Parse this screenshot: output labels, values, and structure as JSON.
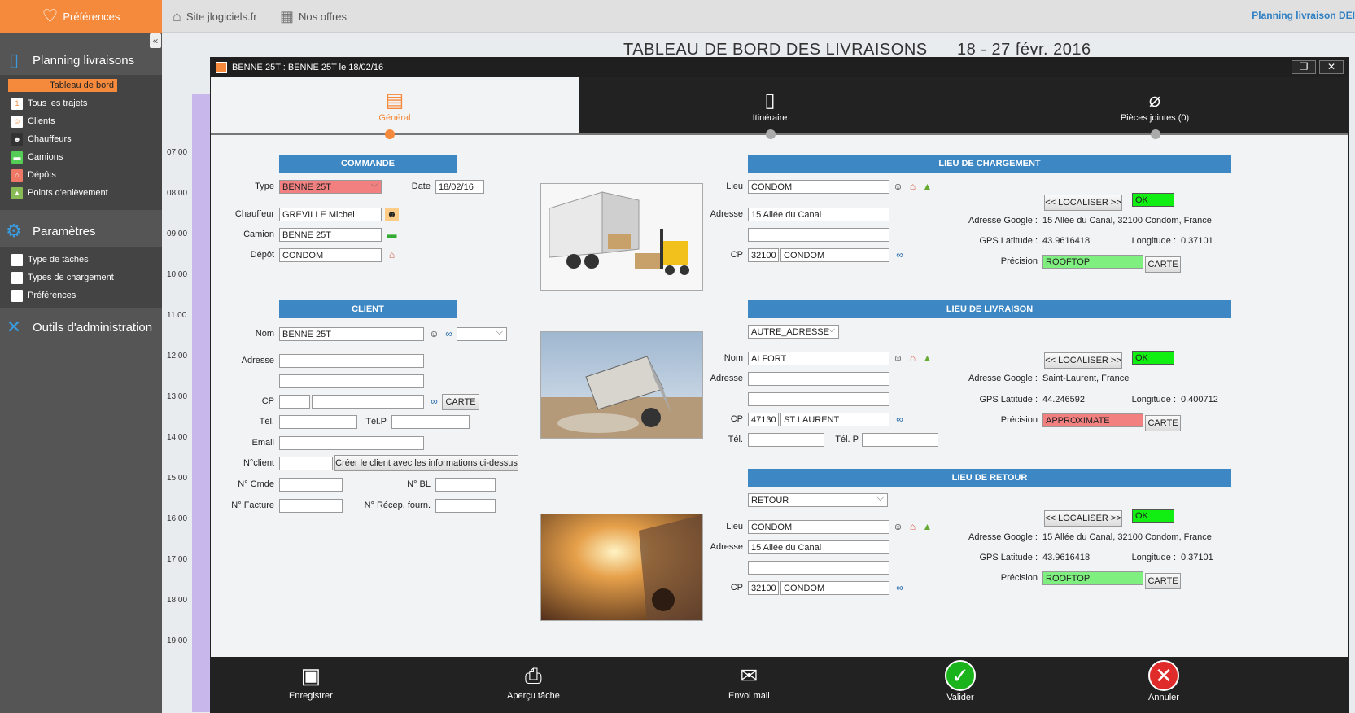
{
  "topbar": {
    "prefs_label": "Préférences",
    "site_link": "Site jlogiciels.fr",
    "offers_link": "Nos offres",
    "right_title": "Planning livraison DEI"
  },
  "sidebar": {
    "planning_title": "Planning livraisons",
    "planning_items": [
      "Tableau de bord",
      "Tous les trajets",
      "Clients",
      "Chauffeurs",
      "Camions",
      "Dépôts",
      "Points d'enlèvement"
    ],
    "params_title": "Paramètres",
    "params_items": [
      "Type de tâches",
      "Types de chargement",
      "Préférences"
    ],
    "admin_title": "Outils d'administration"
  },
  "dashboard": {
    "title": "TABLEAU DE BORD DES LIVRAISONS",
    "period": "18 - 27 févr. 2016",
    "hours": [
      "07.00",
      "08.00",
      "09.00",
      "10.00",
      "11.00",
      "12.00",
      "13.00",
      "14.00",
      "15.00",
      "16.00",
      "17.00",
      "18.00",
      "19.00"
    ]
  },
  "modal": {
    "title": "BENNE 25T : BENNE 25T le 18/02/16",
    "tabs": [
      "Général",
      "Itinéraire",
      "Pièces jointes (0)"
    ]
  },
  "commande": {
    "header": "COMMANDE",
    "type_label": "Type",
    "type_value": "BENNE 25T",
    "date_label": "Date",
    "date_value": "18/02/16",
    "chauffeur_label": "Chauffeur",
    "chauffeur_value": "GREVILLE Michel",
    "camion_label": "Camion",
    "camion_value": "BENNE 25T",
    "depot_label": "Dépôt",
    "depot_value": "CONDOM"
  },
  "client": {
    "header": "CLIENT",
    "nom_label": "Nom",
    "nom_value": "BENNE 25T",
    "adresse_label": "Adresse",
    "cp_label": "CP",
    "carte_label": "CARTE",
    "tel_label": "Tél.",
    "telp_label": "Tél.P",
    "email_label": "Email",
    "nclient_label": "N°client",
    "create_button": "Créer le client avec les informations ci-dessus",
    "ncmde_label": "N° Cmde",
    "nbl_label": "N° BL",
    "nfacture_label": "N° Facture",
    "nrecep_label": "N° Récep. fourn."
  },
  "chargement": {
    "header": "LIEU DE CHARGEMENT",
    "lieu_label": "Lieu",
    "lieu_value": "CONDOM",
    "adresse_label": "Adresse",
    "adresse_value": "15 Allée du Canal",
    "cp_label": "CP",
    "cp_value": "32100",
    "ville_value": "CONDOM",
    "localiser": "<< LOCALISER >>",
    "status": "OK",
    "google_label": "Adresse Google :",
    "google_value": "15 Allée du Canal, 32100 Condom, France",
    "lat_label": "GPS Latitude :",
    "lat_value": "43.9616418",
    "lon_label": "Longitude :",
    "lon_value": "0.37101",
    "prec_label": "Précision",
    "prec_value": "ROOFTOP",
    "carte": "CARTE"
  },
  "livraison": {
    "header": "LIEU DE LIVRAISON",
    "mode_value": "AUTRE_ADRESSE",
    "nom_label": "Nom",
    "nom_value": "ALFORT",
    "adresse_label": "Adresse",
    "cp_label": "CP",
    "cp_value": "47130",
    "ville_value": "ST LAURENT",
    "tel_label": "Tél.",
    "telp_label": "Tél. P",
    "localiser": "<< LOCALISER >>",
    "status": "OK",
    "google_label": "Adresse Google :",
    "google_value": "Saint-Laurent, France",
    "lat_label": "GPS Latitude :",
    "lat_value": "44.246592",
    "lon_label": "Longitude :",
    "lon_value": "0.400712",
    "prec_label": "Précision",
    "prec_value": "APPROXIMATE",
    "carte": "CARTE"
  },
  "retour": {
    "header": "LIEU DE RETOUR",
    "mode_value": "RETOUR",
    "lieu_label": "Lieu",
    "lieu_value": "CONDOM",
    "adresse_label": "Adresse",
    "adresse_value": "15 Allée du Canal",
    "cp_label": "CP",
    "cp_value": "32100",
    "ville_value": "CONDOM",
    "localiser": "<< LOCALISER >>",
    "status": "OK",
    "google_label": "Adresse Google :",
    "google_value": "15 Allée du Canal, 32100 Condom, France",
    "lat_label": "GPS Latitude :",
    "lat_value": "43.9616418",
    "lon_label": "Longitude :",
    "lon_value": "0.37101",
    "prec_label": "Précision",
    "prec_value": "ROOFTOP",
    "carte": "CARTE"
  },
  "footer": {
    "save": "Enregistrer",
    "preview": "Aperçu tâche",
    "mail": "Envoi mail",
    "validate": "Valider",
    "cancel": "Annuler"
  },
  "colors": {
    "accent": "#f58a3c",
    "header_blue": "#3c87c4",
    "ok_green": "#11ee11",
    "rooftop_green": "#7fef7f",
    "approx_red": "#f28080"
  }
}
